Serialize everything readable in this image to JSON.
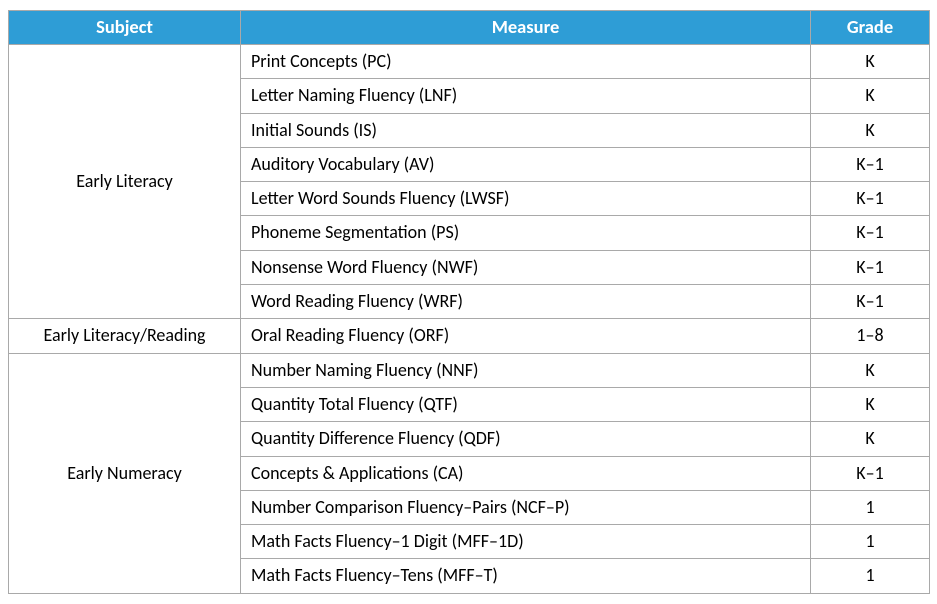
{
  "headers": {
    "subject": "Subject",
    "measure": "Measure",
    "grade": "Grade"
  },
  "groups": [
    {
      "subject": "Early Literacy",
      "rows": [
        {
          "measure": "Print Concepts (PC)",
          "grade": "K"
        },
        {
          "measure": "Letter Naming Fluency (LNF)",
          "grade": "K"
        },
        {
          "measure": "Initial Sounds (IS)",
          "grade": "K"
        },
        {
          "measure": "Auditory Vocabulary (AV)",
          "grade": "K–1"
        },
        {
          "measure": "Letter Word Sounds Fluency (LWSF)",
          "grade": "K–1"
        },
        {
          "measure": "Phoneme Segmentation (PS)",
          "grade": "K–1"
        },
        {
          "measure": "Nonsense Word Fluency (NWF)",
          "grade": "K–1"
        },
        {
          "measure": "Word Reading Fluency (WRF)",
          "grade": "K–1"
        }
      ]
    },
    {
      "subject": "Early Literacy/Reading",
      "rows": [
        {
          "measure": "Oral Reading Fluency (ORF)",
          "grade": "1–8"
        }
      ]
    },
    {
      "subject": "Early Numeracy",
      "rows": [
        {
          "measure": "Number Naming Fluency (NNF)",
          "grade": "K"
        },
        {
          "measure": "Quantity Total Fluency (QTF)",
          "grade": "K"
        },
        {
          "measure": "Quantity Difference Fluency (QDF)",
          "grade": "K"
        },
        {
          "measure": "Concepts & Applications (CA)",
          "grade": "K–1"
        },
        {
          "measure": "Number Comparison Fluency–Pairs (NCF–P)",
          "grade": "1"
        },
        {
          "measure": "Math Facts Fluency–1 Digit (MFF–1D)",
          "grade": "1"
        },
        {
          "measure": "Math Facts Fluency–Tens (MFF–T)",
          "grade": "1"
        }
      ]
    }
  ]
}
